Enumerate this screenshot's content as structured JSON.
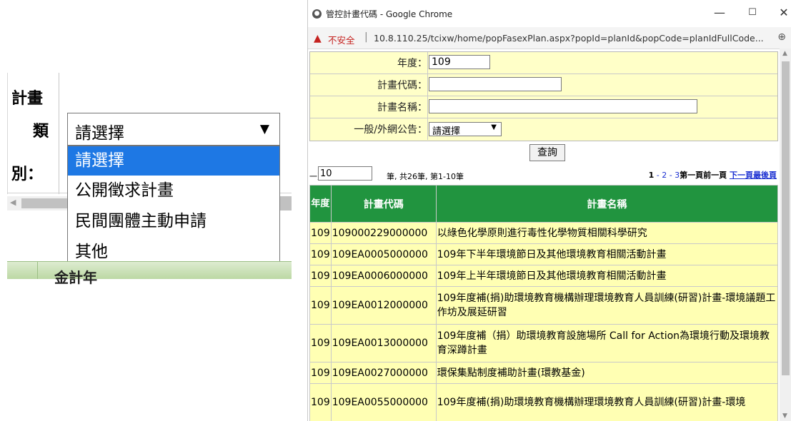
{
  "left_form": {
    "label_line1": "計畫",
    "label_line2": "類",
    "label_line3": "別：",
    "select_value": "請選擇",
    "options": [
      "請選擇",
      "公開徵求計畫",
      "民間團體主動申請",
      "其他"
    ],
    "partial_heading": "金計年"
  },
  "window": {
    "title": "管控計畫代碼 - Google Chrome",
    "insecure_label": "不安全",
    "url": "10.8.110.25/tcixw/home/popFasexPlan.aspx?popId=planId&popCode=planIdFullCode..."
  },
  "search_form": {
    "year_label": "年度：",
    "year_value": "109",
    "code_label": "計畫代碼：",
    "name_label": "計畫名稱：",
    "notice_label": "一般/外網公告：",
    "notice_value": "請選擇",
    "query_button": "查詢"
  },
  "pager": {
    "prefix": "一頁",
    "page_size": "10",
    "summary": "筆, 共26筆, 第1-10筆",
    "current_page": "1",
    "pages_text": " - 2 - 3",
    "first_prev": "第一頁前一頁",
    "next_last": "下一頁最後頁"
  },
  "table": {
    "headers": {
      "year": "年度",
      "code": "計畫代碼",
      "name": "計畫名稱"
    },
    "rows": [
      {
        "year": "109",
        "code": "109000229000000",
        "name": "以綠色化學原則進行毒性化學物質相關科學研究"
      },
      {
        "year": "109",
        "code": "109EA0005000000",
        "name": "109年下半年環境節日及其他環境教育相關活動計畫"
      },
      {
        "year": "109",
        "code": "109EA0006000000",
        "name": "109年上半年環境節日及其他環境教育相關活動計畫"
      },
      {
        "year": "109",
        "code": "109EA0012000000",
        "name": "109年度補(捐)助環境教育機構辦理環境教育人員訓練(研習)計畫-環境議題工作坊及展延研習"
      },
      {
        "year": "109",
        "code": "109EA0013000000",
        "name": "109年度補（捐）助環境教育設施場所 Call for Action為環境行動及環境教育深蹲計畫"
      },
      {
        "year": "109",
        "code": "109EA0027000000",
        "name": "環保集點制度補助計畫(環教基金)"
      },
      {
        "year": "109",
        "code": "109EA0055000000",
        "name": "109年度補(捐)助環境教育機構辦理環境教育人員訓練(研習)計畫-環境"
      }
    ]
  }
}
